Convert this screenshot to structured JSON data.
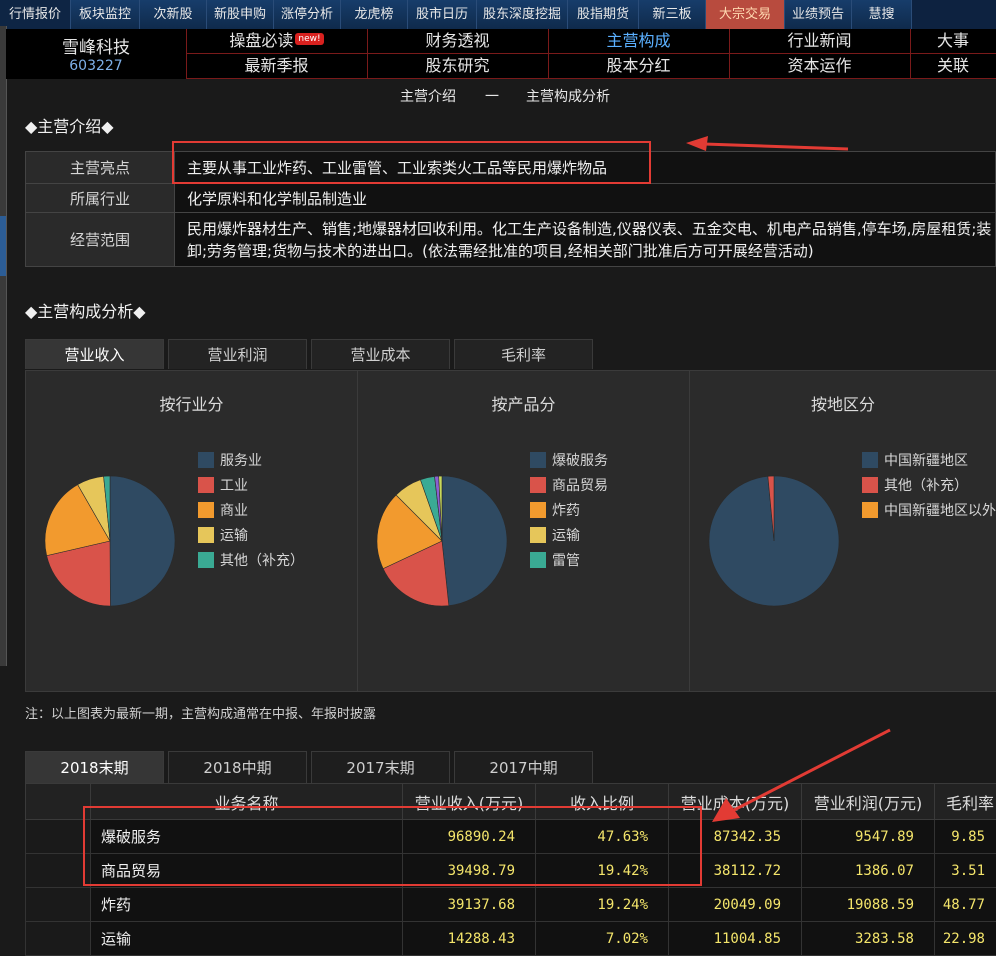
{
  "top_nav": [
    {
      "label": "行情报价"
    },
    {
      "label": "板块监控"
    },
    {
      "label": "次新股"
    },
    {
      "label": "新股申购"
    },
    {
      "label": "涨停分析"
    },
    {
      "label": "龙虎榜"
    },
    {
      "label": "股市日历"
    },
    {
      "label": "股东深度挖掘"
    },
    {
      "label": "股指期货"
    },
    {
      "label": "新三板"
    },
    {
      "label": "大宗交易",
      "active": true
    },
    {
      "label": "业绩预告"
    },
    {
      "label": "慧搜"
    }
  ],
  "stock": {
    "name": "雪峰科技",
    "code": "603227"
  },
  "sub_nav": {
    "row1": [
      {
        "label": "操盘必读",
        "badge": "new!"
      },
      {
        "label": "财务透视"
      },
      {
        "label": "主营构成",
        "active": true
      },
      {
        "label": "行业新闻"
      },
      {
        "label": "大事"
      }
    ],
    "row2": [
      {
        "label": "最新季报"
      },
      {
        "label": "股东研究"
      },
      {
        "label": "股本分红"
      },
      {
        "label": "资本运作"
      },
      {
        "label": "关联"
      }
    ]
  },
  "breadcrumb": {
    "left": "主营介绍",
    "sep": "一",
    "right": "主营构成分析"
  },
  "intro": {
    "title": "◆主营介绍◆",
    "rows": [
      {
        "label": "主营亮点",
        "value": "主要从事工业炸药、工业雷管、工业索类火工品等民用爆炸物品"
      },
      {
        "label": "所属行业",
        "value": "化学原料和化学制品制造业"
      },
      {
        "label": "经营范围",
        "value": "民用爆炸器材生产、销售;地爆器材回收利用。化工生产设备制造,仪器仪表、五金交电、机电产品销售,停车场,房屋租赁;装卸;劳务管理;货物与技术的进出口。(依法需经批准的项目,经相关部门批准后方可开展经营活动)"
      }
    ]
  },
  "analysis": {
    "title": "◆主营构成分析◆",
    "tabs": [
      {
        "label": "营业收入",
        "active": true
      },
      {
        "label": "营业利润"
      },
      {
        "label": "营业成本"
      },
      {
        "label": "毛利率"
      }
    ]
  },
  "chart_data": [
    {
      "type": "pie",
      "title": "按行业分",
      "labels": [
        "服务业",
        "工业",
        "商业",
        "运输",
        "其他（补充）"
      ],
      "values": [
        47.6,
        20.5,
        19.4,
        6.4,
        1.5
      ],
      "colors": [
        "#2f4a62",
        "#d9534a",
        "#f29a2e",
        "#e6c65a",
        "#3aaa94"
      ]
    },
    {
      "type": "pie",
      "title": "按产品分",
      "labels": [
        "爆破服务",
        "商品贸易",
        "炸药",
        "运输",
        "雷管"
      ],
      "values": [
        47.6,
        19.4,
        19.2,
        7.0,
        3.5,
        1.0,
        0.8
      ],
      "colors": [
        "#2f4a62",
        "#d9534a",
        "#f29a2e",
        "#e6c65a",
        "#3aaa94",
        "#8a5fd1",
        "#c8d85a"
      ]
    },
    {
      "type": "pie",
      "title": "按地区分",
      "labels": [
        "中国新疆地区",
        "其他（补充）",
        "中国新疆地区以外"
      ],
      "values": [
        98.5,
        1.5,
        0
      ],
      "colors": [
        "#2f4a62",
        "#d9534a",
        "#f29a2e"
      ]
    }
  ],
  "note": "注：以上图表为最新一期，主营构成通常在中报、年报时披露",
  "period_tabs": [
    {
      "label": "2018末期",
      "active": true
    },
    {
      "label": "2018中期"
    },
    {
      "label": "2017末期"
    },
    {
      "label": "2017中期"
    }
  ],
  "table": {
    "headers": [
      "业务名称",
      "营业收入(万元)",
      "收入比例",
      "营业成本(万元)",
      "营业利润(万元)",
      "毛利率"
    ],
    "rows": [
      [
        "爆破服务",
        "96890.24",
        "47.63%",
        "87342.35",
        "9547.89",
        "9.85"
      ],
      [
        "商品贸易",
        "39498.79",
        "19.42%",
        "38112.72",
        "1386.07",
        "3.51"
      ],
      [
        "炸药",
        "39137.68",
        "19.24%",
        "20049.09",
        "19088.59",
        "48.77"
      ],
      [
        "运输",
        "14288.43",
        "7.02%",
        "11004.85",
        "3283.58",
        "22.98"
      ]
    ]
  }
}
